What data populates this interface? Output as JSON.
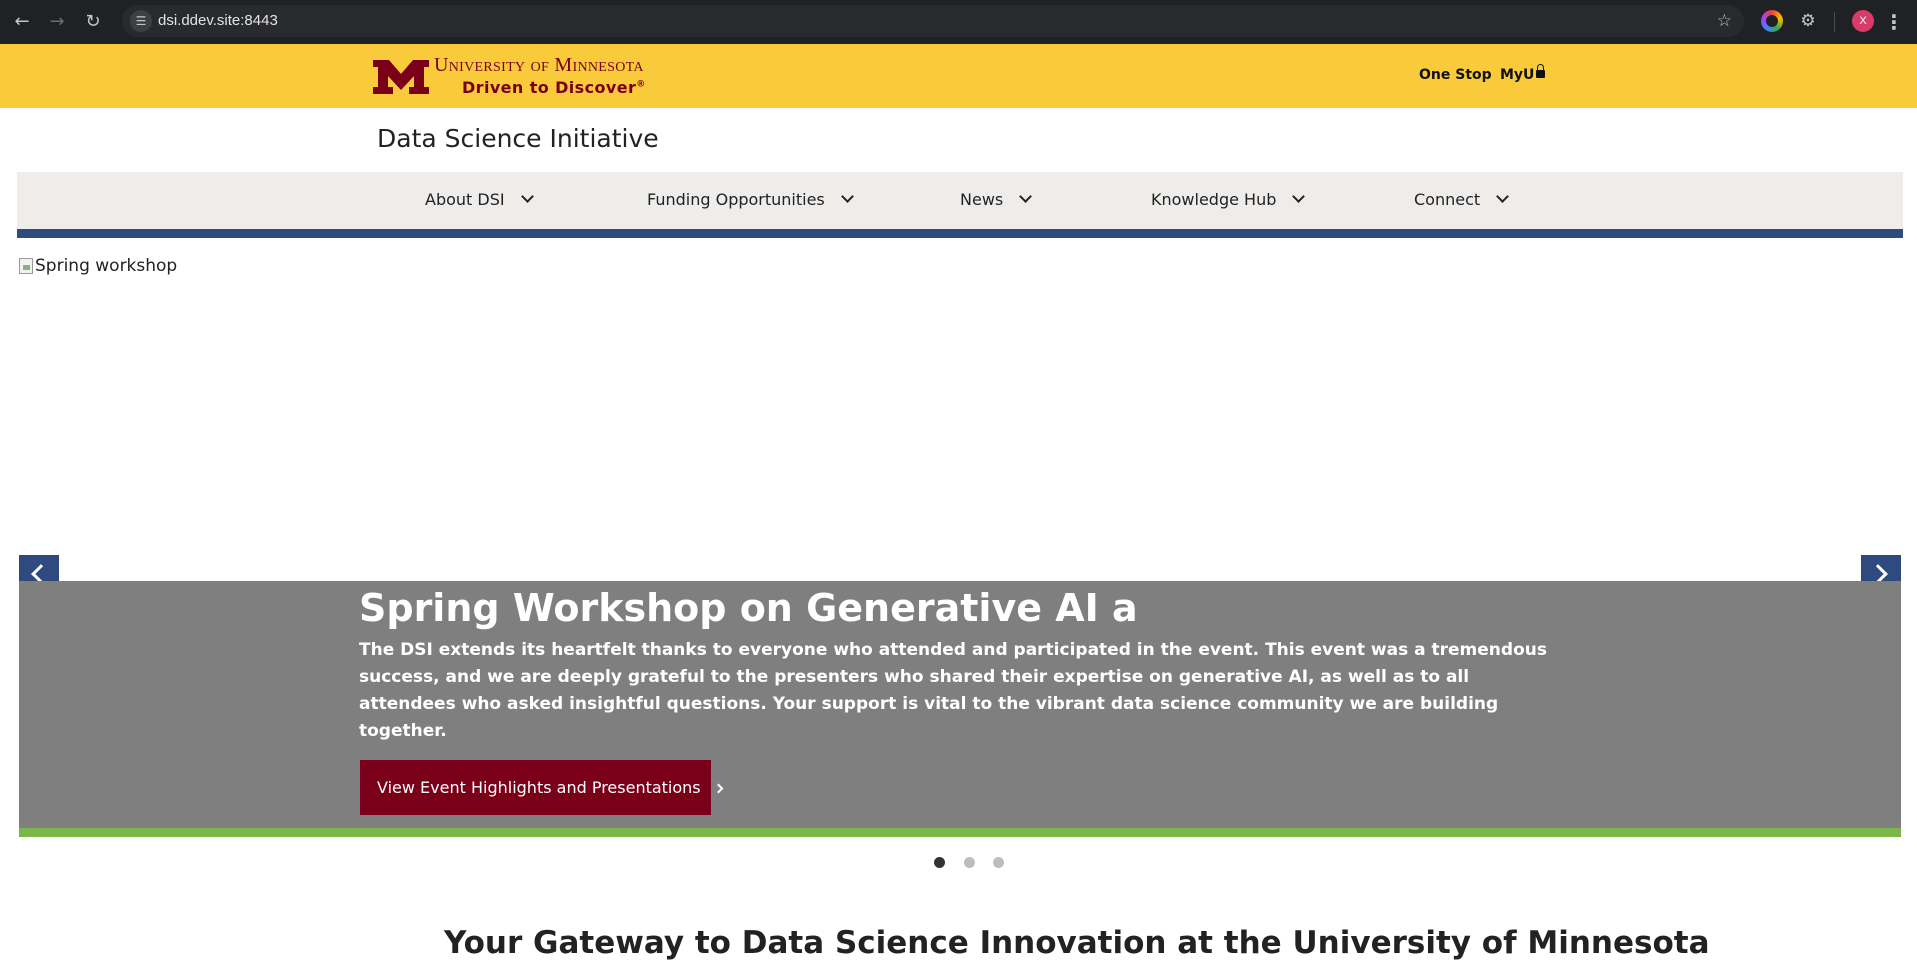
{
  "browser": {
    "url": "dsi.ddev.site:8443",
    "profile_initial": "X",
    "icons": [
      "back-icon",
      "forward-icon",
      "reload-icon",
      "site-settings-icon",
      "bookmark-star-icon",
      "color-extension-icon",
      "extensions-puzzle-icon",
      "menu-kebab-icon"
    ]
  },
  "header": {
    "university_name": "University of Minnesota",
    "tagline": "Driven to Discover",
    "tagline_mark": "®",
    "links": [
      {
        "label": "One Stop"
      },
      {
        "label": "MyU"
      }
    ]
  },
  "site": {
    "title": "Data Science Initiative"
  },
  "nav": {
    "items": [
      {
        "label": "About DSI"
      },
      {
        "label": "Funding Opportunities"
      },
      {
        "label": "News"
      },
      {
        "label": "Knowledge Hub"
      },
      {
        "label": "Connect"
      }
    ]
  },
  "carousel": {
    "image_alt": "Spring workshop",
    "heading": "Spring Workshop on Generative AI a",
    "text": "The DSI extends its heartfelt thanks to everyone who attended and participated in the event. This event was a tremendous success, and we are deeply grateful to the presenters who shared their expertise on generative AI, as well as to all attendees who asked insightful questions. Your support is vital to the vibrant data science community we are building together.",
    "cta_label": "View Event Highlights and Presentations",
    "slide_count": 3,
    "active_slide": 1
  },
  "section": {
    "heading": "Your Gateway to Data Science Innovation at the University of Minnesota"
  },
  "colors": {
    "gold": "#f9cb3a",
    "maroon": "#7a0019",
    "nav_blue": "#2e4a7f",
    "caption_gray": "#7f7f7f",
    "accent_green": "#7ab648"
  }
}
